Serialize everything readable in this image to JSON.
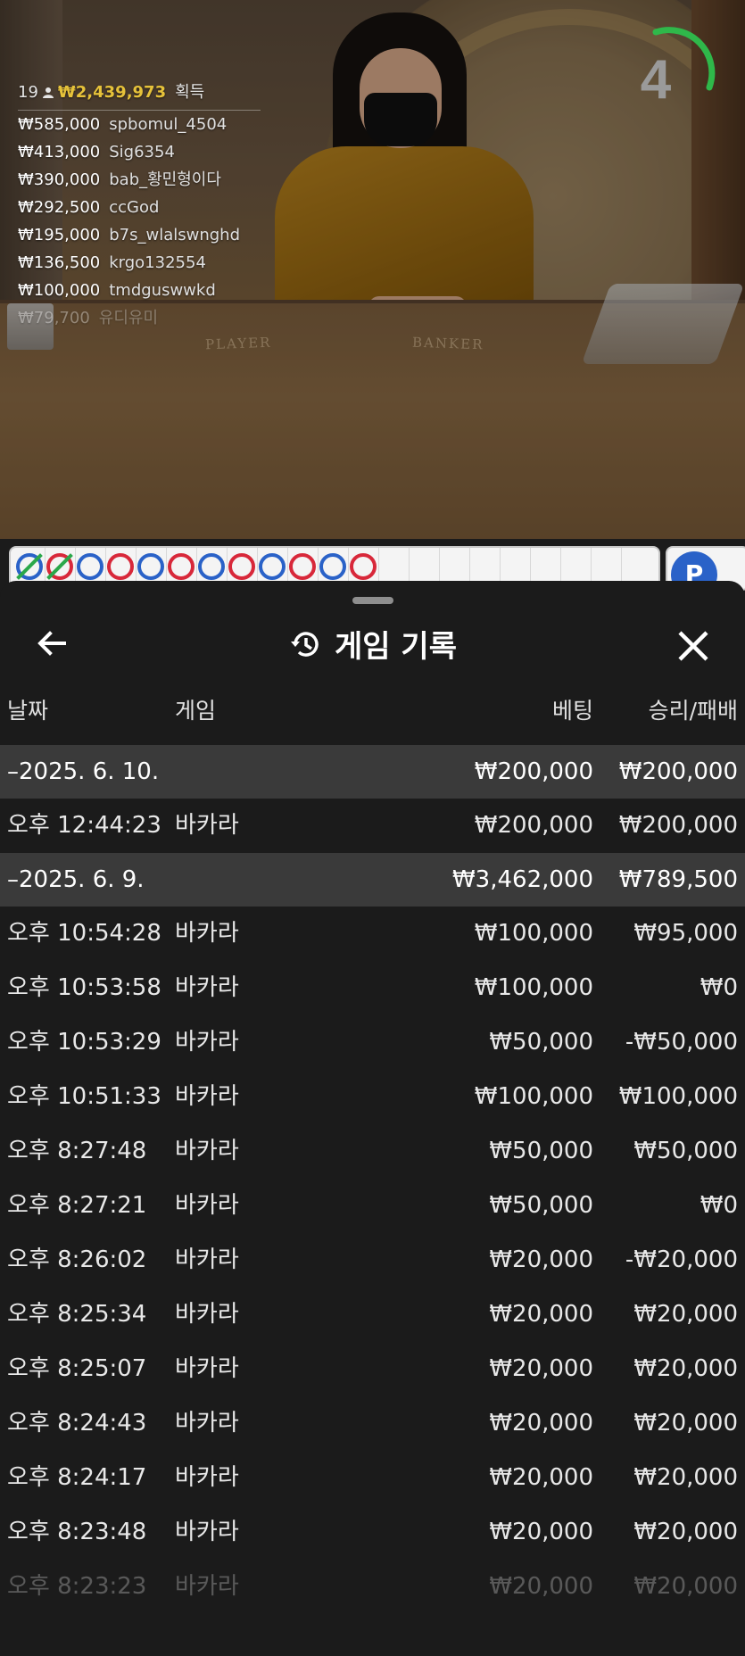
{
  "stream": {
    "table_labels": {
      "player": "PLAYER",
      "banker": "BANKER"
    },
    "winners": {
      "count": "19",
      "total": "₩2,439,973",
      "suffix": "획득",
      "entries": [
        {
          "amount": "₩585,000",
          "name": "spbomul_4504"
        },
        {
          "amount": "₩413,000",
          "name": "Sig6354"
        },
        {
          "amount": "₩390,000",
          "name": "bab_황민형이다"
        },
        {
          "amount": "₩292,500",
          "name": "ccGod"
        },
        {
          "amount": "₩195,000",
          "name": "b7s_wlalswnghd"
        },
        {
          "amount": "₩136,500",
          "name": "krgo132554"
        },
        {
          "amount": "₩100,000",
          "name": "tmdguswwkd"
        },
        {
          "amount": "₩79,700",
          "name": "유디유미"
        }
      ]
    },
    "timer": {
      "seconds": "4",
      "color": "#2fb84a"
    }
  },
  "road": {
    "results": [
      "tie-player",
      "tie-banker",
      "player",
      "banker",
      "player",
      "banker",
      "player",
      "banker",
      "player",
      "banker",
      "player",
      "banker"
    ],
    "player_color": "#2a62c8",
    "banker_color": "#d8283a",
    "tie_color": "#2aa84a",
    "side_button": "P"
  },
  "sheet": {
    "title": "게임 기록",
    "back_icon": "arrow-left-icon",
    "history_icon": "history-icon",
    "close_icon": "close-icon",
    "columns": {
      "date": "날짜",
      "game": "게임",
      "bet": "베팅",
      "winloss": "승리/패배"
    },
    "groups": [
      {
        "date": "–2025. 6. 10.",
        "bet": "₩200,000",
        "winloss": "₩200,000",
        "items": [
          {
            "time": "오후 12:44:23",
            "game": "바카라",
            "bet": "₩200,000",
            "winloss": "₩200,000"
          }
        ]
      },
      {
        "date": "–2025. 6. 9.",
        "bet": "₩3,462,000",
        "winloss": "₩789,500",
        "items": [
          {
            "time": "오후 10:54:28",
            "game": "바카라",
            "bet": "₩100,000",
            "winloss": "₩95,000"
          },
          {
            "time": "오후 10:53:58",
            "game": "바카라",
            "bet": "₩100,000",
            "winloss": "₩0"
          },
          {
            "time": "오후 10:53:29",
            "game": "바카라",
            "bet": "₩50,000",
            "winloss": "-₩50,000"
          },
          {
            "time": "오후 10:51:33",
            "game": "바카라",
            "bet": "₩100,000",
            "winloss": "₩100,000"
          },
          {
            "time": "오후 8:27:48",
            "game": "바카라",
            "bet": "₩50,000",
            "winloss": "₩50,000"
          },
          {
            "time": "오후 8:27:21",
            "game": "바카라",
            "bet": "₩50,000",
            "winloss": "₩0"
          },
          {
            "time": "오후 8:26:02",
            "game": "바카라",
            "bet": "₩20,000",
            "winloss": "-₩20,000"
          },
          {
            "time": "오후 8:25:34",
            "game": "바카라",
            "bet": "₩20,000",
            "winloss": "₩20,000"
          },
          {
            "time": "오후 8:25:07",
            "game": "바카라",
            "bet": "₩20,000",
            "winloss": "₩20,000"
          },
          {
            "time": "오후 8:24:43",
            "game": "바카라",
            "bet": "₩20,000",
            "winloss": "₩20,000"
          },
          {
            "time": "오후 8:24:17",
            "game": "바카라",
            "bet": "₩20,000",
            "winloss": "₩20,000"
          },
          {
            "time": "오후 8:23:48",
            "game": "바카라",
            "bet": "₩20,000",
            "winloss": "₩20,000"
          },
          {
            "time": "오후 8:23:23",
            "game": "바카라",
            "bet": "₩20,000",
            "winloss": "₩20,000"
          }
        ]
      }
    ]
  }
}
